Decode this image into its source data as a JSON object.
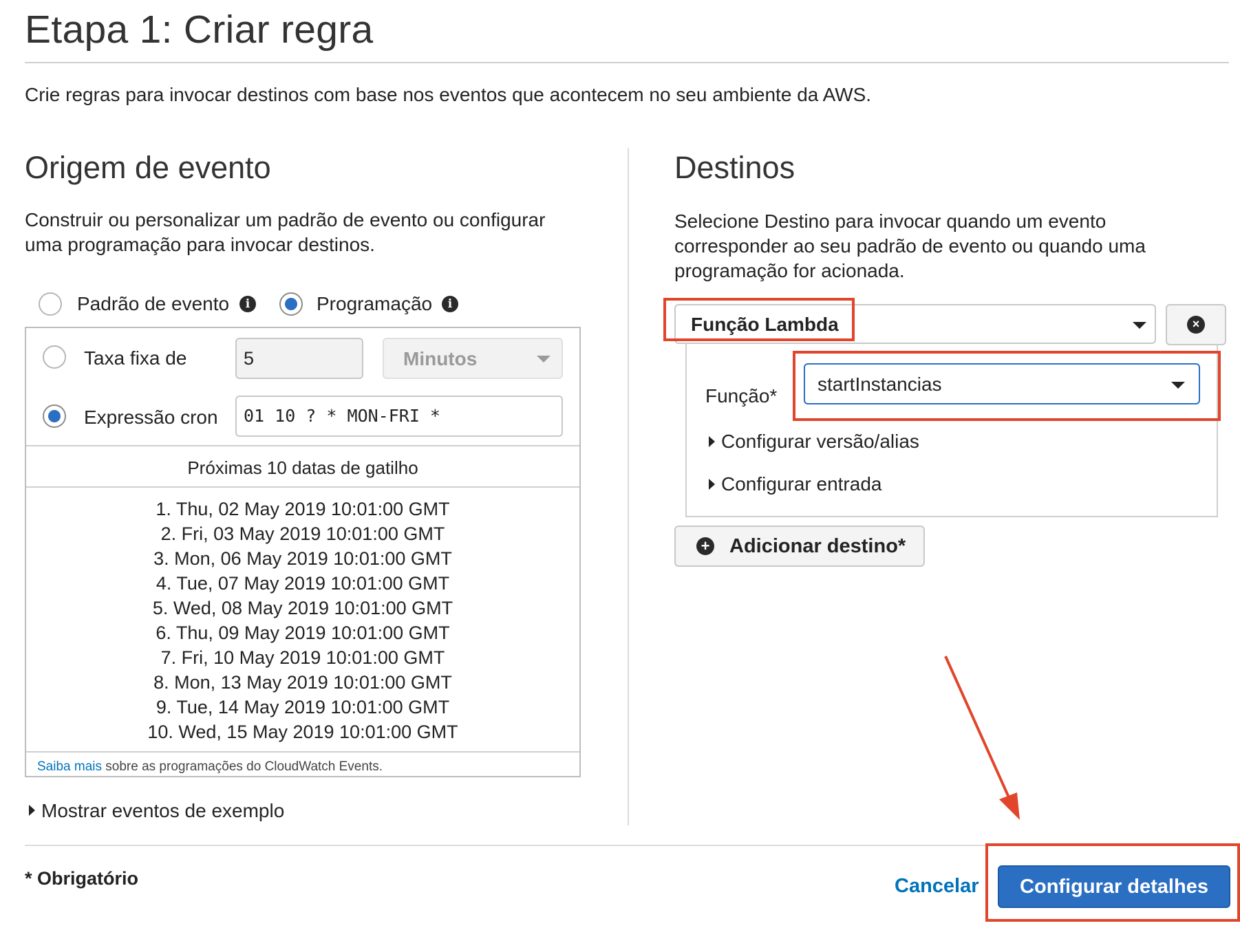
{
  "page": {
    "title": "Etapa 1: Criar regra",
    "description": "Crie regras para invocar destinos com base nos eventos que acontecem no seu ambiente da AWS."
  },
  "event_source": {
    "title": "Origem de evento",
    "description_line1": "Construir ou personalizar um padrão de evento ou configurar",
    "description_line2": "uma programação para invocar destinos.",
    "mode_options": [
      {
        "label": "Padrão de evento",
        "selected": false
      },
      {
        "label": "Programação",
        "selected": true
      }
    ],
    "fixed_rate": {
      "label": "Taxa fixa de",
      "value": "5",
      "unit": "Minutos",
      "selected": false
    },
    "cron": {
      "label": "Expressão cron",
      "value": "01 10 ? * MON-FRI *",
      "selected": true
    },
    "next_dates_header": "Próximas 10 datas de gatilho",
    "next_dates": [
      "1. Thu, 02 May 2019 10:01:00 GMT",
      "2. Fri, 03 May 2019 10:01:00 GMT",
      "3. Mon, 06 May 2019 10:01:00 GMT",
      "4. Tue, 07 May 2019 10:01:00 GMT",
      "5. Wed, 08 May 2019 10:01:00 GMT",
      "6. Thu, 09 May 2019 10:01:00 GMT",
      "7. Fri, 10 May 2019 10:01:00 GMT",
      "8. Mon, 13 May 2019 10:01:00 GMT",
      "9. Tue, 14 May 2019 10:01:00 GMT",
      "10. Wed, 15 May 2019 10:01:00 GMT"
    ],
    "learn_more_link": "Saiba mais",
    "learn_more_text": "sobre as programações do CloudWatch Events.",
    "show_sample_events": "Mostrar eventos de exemplo"
  },
  "targets": {
    "title": "Destinos",
    "description_line1": "Selecione Destino para invocar quando um evento",
    "description_line2": "corresponder ao seu padrão de evento ou quando uma",
    "description_line3": "programação for acionada.",
    "target_type": "Função Lambda",
    "function_label": "Função*",
    "function_value": "startInstancias",
    "configure_version": "Configurar versão/alias",
    "configure_input": "Configurar entrada",
    "add_target": "Adicionar destino*"
  },
  "footer": {
    "required_note": "* Obrigatório",
    "cancel": "Cancelar",
    "configure_details": "Configurar detalhes"
  },
  "colors": {
    "accent": "#2b6fc2",
    "annotation": "#e1462c",
    "link": "#0073bb"
  }
}
